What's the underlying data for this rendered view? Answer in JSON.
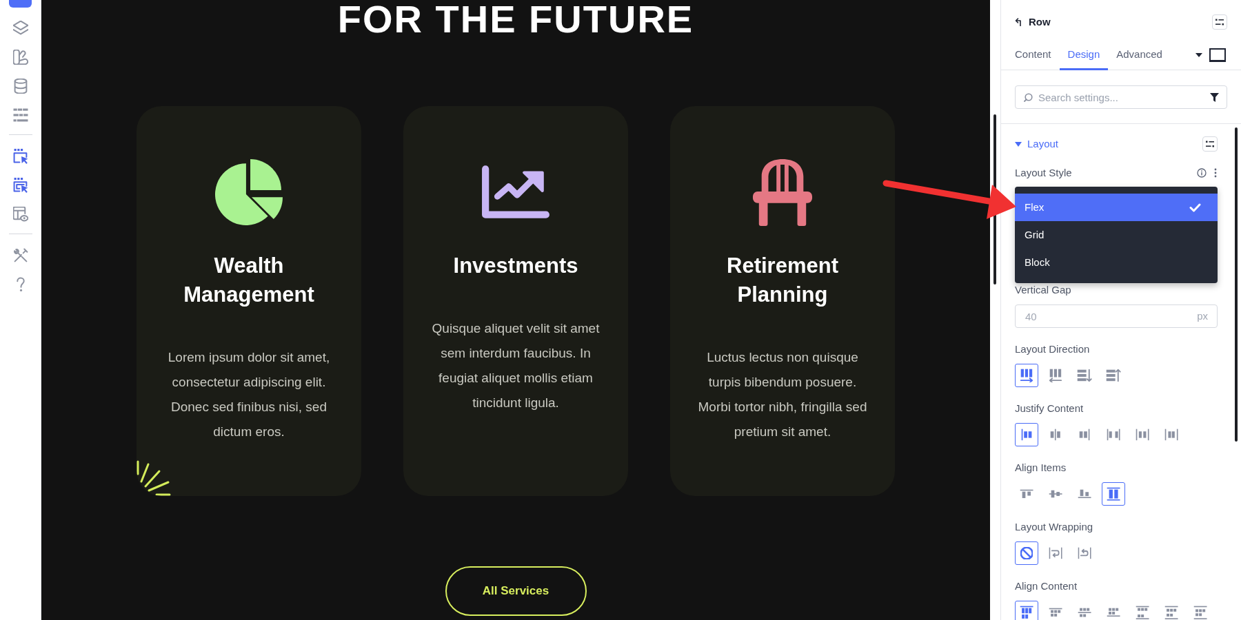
{
  "sidebar": {
    "groups": [
      [
        {
          "kind": "layers",
          "active": false
        },
        {
          "kind": "shapes",
          "active": false
        },
        {
          "kind": "database",
          "active": false
        },
        {
          "kind": "rows",
          "active": false
        }
      ],
      [
        {
          "kind": "cursor-frame",
          "active": true
        },
        {
          "kind": "cursor-frame-double",
          "active": true
        },
        {
          "kind": "layout-preview",
          "active": false
        }
      ],
      [
        {
          "kind": "tools",
          "active": false
        },
        {
          "kind": "help",
          "active": false
        }
      ]
    ]
  },
  "canvas": {
    "heading": "FOR THE FUTURE",
    "cards": [
      {
        "kind": "pie",
        "color": "#a9f291",
        "title": "Wealth Management",
        "text": "Lorem ipsum dolor sit amet, consectetur adipiscing elit. Donec sed finibus nisi, sed dictum eros.",
        "accent": true
      },
      {
        "kind": "chart",
        "color": "#c8b5f4",
        "title": "Investments",
        "text": "Quisque aliquet velit sit amet sem interdum faucibus. In feugiat aliquet mollis etiam tincidunt ligula.",
        "accent": false
      },
      {
        "kind": "chair",
        "color": "#e57884",
        "title": "Retirement Planning",
        "text": "Luctus lectus non quisque turpis bibendum posuere. Morbi tortor nibh, fringilla sed pretium sit amet.",
        "accent": false
      }
    ],
    "button": {
      "label": "All Services"
    }
  },
  "panel": {
    "title": "Row",
    "tabs": [
      {
        "label": "Content",
        "selected": false
      },
      {
        "label": "Design",
        "selected": true
      },
      {
        "label": "Advanced",
        "selected": false
      }
    ],
    "search": {
      "placeholder": "Search settings..."
    },
    "section": {
      "title": "Layout",
      "expanded": true,
      "fields": [
        {
          "kind": "select",
          "label": "Layout Style",
          "hovered": true,
          "expanded": true,
          "options": [
            {
              "label": "Flex",
              "selected": true
            },
            {
              "label": "Grid",
              "selected": false
            },
            {
              "label": "Block",
              "selected": false
            }
          ]
        },
        {
          "kind": "number",
          "label": "Vertical Gap",
          "hovered": false,
          "placeholder": "40",
          "unit": "px"
        },
        {
          "kind": "choice",
          "label": "Layout Direction",
          "hovered": false,
          "options": [
            {
              "kind": "row",
              "selected": true
            },
            {
              "kind": "row-reverse",
              "selected": false
            },
            {
              "kind": "column",
              "selected": false
            },
            {
              "kind": "column-reverse",
              "selected": false
            }
          ]
        },
        {
          "kind": "choice",
          "label": "Justify Content",
          "hovered": false,
          "options": [
            {
              "kind": "justify-start",
              "selected": true
            },
            {
              "kind": "justify-center",
              "selected": false
            },
            {
              "kind": "justify-end",
              "selected": false
            },
            {
              "kind": "justify-between",
              "selected": false
            },
            {
              "kind": "justify-around",
              "selected": false
            },
            {
              "kind": "justify-evenly",
              "selected": false
            }
          ]
        },
        {
          "kind": "choice",
          "label": "Align Items",
          "hovered": false,
          "options": [
            {
              "kind": "items-start",
              "selected": false
            },
            {
              "kind": "items-center",
              "selected": false
            },
            {
              "kind": "items-end",
              "selected": false
            },
            {
              "kind": "items-stretch",
              "selected": true
            }
          ]
        },
        {
          "kind": "choice",
          "label": "Layout Wrapping",
          "hovered": false,
          "options": [
            {
              "kind": "nowrap",
              "selected": true
            },
            {
              "kind": "wrap",
              "selected": false
            },
            {
              "kind": "wrap-reverse",
              "selected": false
            }
          ]
        },
        {
          "kind": "choice",
          "label": "Align Content",
          "hovered": false,
          "options": [
            {
              "kind": "content-stretch",
              "selected": true
            },
            {
              "kind": "content-start",
              "selected": false
            },
            {
              "kind": "content-center",
              "selected": false
            },
            {
              "kind": "content-end",
              "selected": false
            },
            {
              "kind": "content-between",
              "selected": false
            },
            {
              "kind": "content-around",
              "selected": false
            },
            {
              "kind": "content-evenly",
              "selected": false
            }
          ]
        }
      ]
    }
  }
}
